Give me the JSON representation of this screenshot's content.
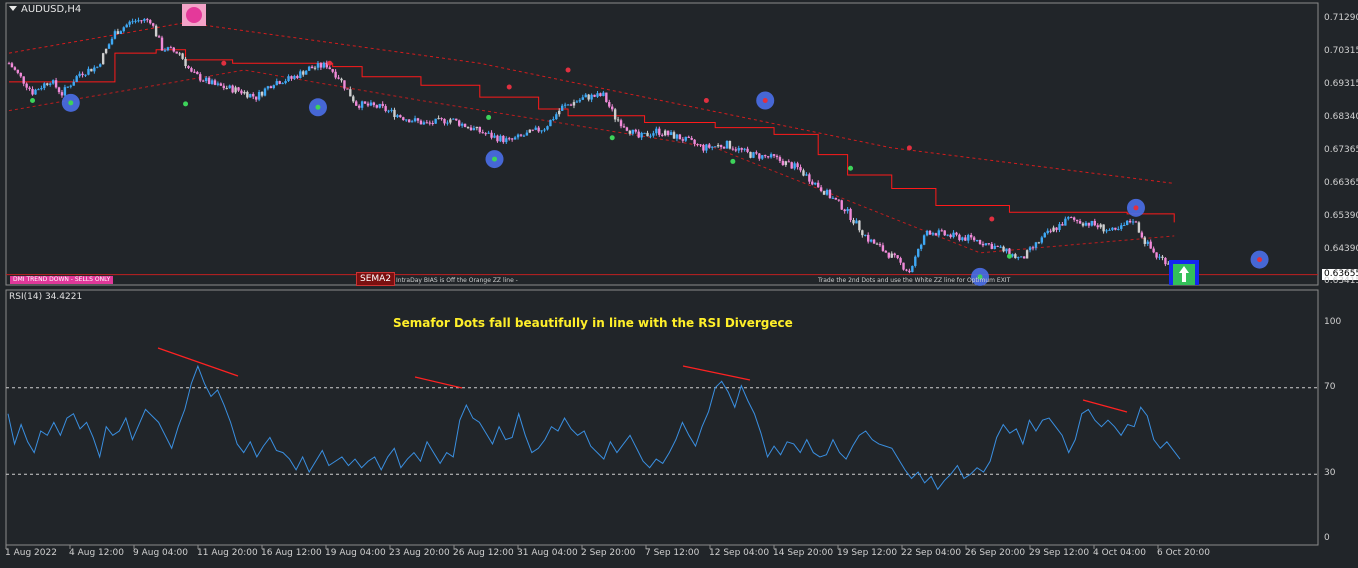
{
  "window": {
    "symbol": "AUDUSD,H4",
    "current_price": "0.63655"
  },
  "indicators": {
    "rsi_title": "RSI(14) 34.4221",
    "annotation": "Semafor Dots fall beautifully in line with the RSI Divergece",
    "banner": "DMI TREND DOWN - SELLS ONLY",
    "sema_label": "SEMA2",
    "bias_note": "IntraDay BIAS is Off the Orange ZZ line -",
    "exit_note": "Trade the 2nd Dots and use the White ZZ line for Optimum EXIT"
  },
  "colors": {
    "background": "#212529",
    "bull_candle": "#3fa9f5",
    "bear_candle": "#f08ad8",
    "neutral_candle": "#cfcfcf",
    "ma_line": "#ff1a1a",
    "rsi_line": "#3a8fe0",
    "semafor_ring": "#4a6fe8",
    "divergence": "#ff2222",
    "annotation": "#ffef2a"
  },
  "chart_data": [
    {
      "type": "candlestick",
      "title": "AUDUSD,H4",
      "y_ticks": [
        "0.71290",
        "0.70315",
        "0.69315",
        "0.68340",
        "0.67365",
        "0.66365",
        "0.65390",
        "0.64390",
        "0.63415"
      ],
      "ylim": [
        0.6335,
        0.7168
      ],
      "x_ticks": [
        "1 Aug 2022",
        "4 Aug 12:00",
        "9 Aug 04:00",
        "11 Aug 20:00",
        "16 Aug 12:00",
        "19 Aug 04:00",
        "23 Aug 20:00",
        "26 Aug 12:00",
        "31 Aug 04:00",
        "2 Sep 20:00",
        "7 Sep 12:00",
        "12 Sep 04:00",
        "14 Sep 20:00",
        "19 Sep 12:00",
        "22 Sep 04:00",
        "26 Sep 20:00",
        "29 Sep 12:00",
        "4 Oct 04:00",
        "6 Oct 20:00"
      ],
      "close_path": [
        [
          0,
          0.699
        ],
        [
          8,
          0.6905
        ],
        [
          14,
          0.694
        ],
        [
          18,
          0.69
        ],
        [
          24,
          0.696
        ],
        [
          30,
          0.698
        ],
        [
          36,
          0.708
        ],
        [
          42,
          0.7115
        ],
        [
          48,
          0.7118
        ],
        [
          52,
          0.7035
        ],
        [
          58,
          0.702
        ],
        [
          62,
          0.696
        ],
        [
          70,
          0.6925
        ],
        [
          78,
          0.691
        ],
        [
          84,
          0.689
        ],
        [
          90,
          0.6935
        ],
        [
          96,
          0.6945
        ],
        [
          102,
          0.6975
        ],
        [
          108,
          0.6985
        ],
        [
          112,
          0.695
        ],
        [
          118,
          0.687
        ],
        [
          126,
          0.686
        ],
        [
          134,
          0.683
        ],
        [
          142,
          0.681
        ],
        [
          150,
          0.6825
        ],
        [
          158,
          0.6795
        ],
        [
          164,
          0.6775
        ],
        [
          170,
          0.676
        ],
        [
          176,
          0.678
        ],
        [
          182,
          0.68
        ],
        [
          188,
          0.686
        ],
        [
          196,
          0.689
        ],
        [
          202,
          0.6895
        ],
        [
          206,
          0.683
        ],
        [
          214,
          0.677
        ],
        [
          220,
          0.679
        ],
        [
          228,
          0.677
        ],
        [
          236,
          0.674
        ],
        [
          244,
          0.675
        ],
        [
          252,
          0.672
        ],
        [
          260,
          0.671
        ],
        [
          268,
          0.668
        ],
        [
          276,
          0.662
        ],
        [
          284,
          0.656
        ],
        [
          292,
          0.647
        ],
        [
          300,
          0.642
        ],
        [
          306,
          0.6375
        ],
        [
          312,
          0.6495
        ],
        [
          320,
          0.648
        ],
        [
          328,
          0.647
        ],
        [
          336,
          0.6445
        ],
        [
          344,
          0.641
        ],
        [
          352,
          0.648
        ],
        [
          360,
          0.653
        ],
        [
          368,
          0.6515
        ],
        [
          376,
          0.649
        ],
        [
          382,
          0.653
        ],
        [
          386,
          0.6465
        ],
        [
          390,
          0.642
        ],
        [
          396,
          0.6395
        ]
      ],
      "moving_average_steps": [
        [
          0,
          0.6935
        ],
        [
          30,
          0.6935
        ],
        [
          36,
          0.702
        ],
        [
          50,
          0.703
        ],
        [
          60,
          0.7
        ],
        [
          76,
          0.699
        ],
        [
          110,
          0.698
        ],
        [
          120,
          0.695
        ],
        [
          140,
          0.6925
        ],
        [
          160,
          0.689
        ],
        [
          180,
          0.6855
        ],
        [
          190,
          0.6835
        ],
        [
          210,
          0.6835
        ],
        [
          216,
          0.6815
        ],
        [
          240,
          0.68
        ],
        [
          260,
          0.678
        ],
        [
          275,
          0.672
        ],
        [
          285,
          0.666
        ],
        [
          300,
          0.662
        ],
        [
          315,
          0.657
        ],
        [
          340,
          0.655
        ],
        [
          380,
          0.6545
        ],
        [
          396,
          0.652
        ]
      ],
      "long_ma_line": [
        [
          0,
          0.702
        ],
        [
          60,
          0.711
        ],
        [
          160,
          0.699
        ],
        [
          300,
          0.674
        ],
        [
          396,
          0.6635
        ]
      ],
      "support_line": [
        [
          0,
          0.685
        ],
        [
          80,
          0.697
        ],
        [
          140,
          0.688
        ],
        [
          240,
          0.674
        ],
        [
          330,
          0.643
        ],
        [
          396,
          0.648
        ]
      ],
      "semafor_major": [
        [
          21,
          0.6873
        ],
        [
          105,
          0.686
        ],
        [
          165,
          0.6707
        ],
        [
          257,
          0.688
        ],
        [
          330,
          0.6359
        ],
        [
          383,
          0.6563
        ],
        [
          425,
          0.641
        ]
      ],
      "semafor_high": [
        [
          73,
          0.699
        ],
        [
          109,
          0.699
        ],
        [
          170,
          0.692
        ],
        [
          190,
          0.697
        ],
        [
          237,
          0.688
        ],
        [
          306,
          0.674
        ],
        [
          334,
          0.653
        ]
      ],
      "semafor_low": [
        [
          8,
          0.688
        ],
        [
          60,
          0.687
        ],
        [
          163,
          0.683
        ],
        [
          205,
          0.677
        ],
        [
          246,
          0.67
        ],
        [
          286,
          0.668
        ],
        [
          340,
          0.642
        ]
      ],
      "current_price": 0.63655
    },
    {
      "type": "line",
      "title": "RSI(14) 34.4221",
      "ylim": [
        0,
        100
      ],
      "y_ticks": [
        "100",
        "70",
        "30",
        "0"
      ],
      "levels": [
        70,
        30
      ],
      "values": [
        58,
        44,
        53,
        45,
        40,
        50,
        48,
        54,
        48,
        56,
        58,
        51,
        54,
        47,
        38,
        52,
        48,
        50,
        56,
        46,
        53,
        60,
        57,
        54,
        48,
        42,
        52,
        60,
        72,
        80,
        72,
        66,
        69,
        62,
        54,
        44,
        40,
        45,
        38,
        43,
        47,
        41,
        40,
        37,
        32,
        38,
        31,
        36,
        41,
        34,
        36,
        38,
        34,
        37,
        33,
        36,
        38,
        32,
        38,
        42,
        33,
        37,
        40,
        36,
        45,
        40,
        35,
        40,
        38,
        55,
        62,
        56,
        54,
        49,
        44,
        52,
        46,
        47,
        58,
        48,
        40,
        42,
        46,
        52,
        50,
        56,
        51,
        48,
        50,
        43,
        40,
        37,
        45,
        40,
        44,
        48,
        42,
        36,
        33,
        37,
        35,
        40,
        46,
        54,
        48,
        43,
        52,
        59,
        70,
        73,
        68,
        61,
        71,
        64,
        58,
        49,
        38,
        43,
        39,
        45,
        44,
        40,
        46,
        40,
        38,
        39,
        46,
        40,
        37,
        43,
        48,
        50,
        46,
        44,
        43,
        42,
        37,
        32,
        28,
        31,
        26,
        29,
        23,
        27,
        30,
        34,
        28,
        30,
        33,
        31,
        36,
        47,
        53,
        49,
        51,
        44,
        55,
        50,
        55,
        56,
        52,
        48,
        40,
        46,
        58,
        60,
        55,
        52,
        55,
        52,
        48,
        53,
        52,
        61,
        57,
        46,
        42,
        45,
        41,
        37
      ]
    }
  ]
}
